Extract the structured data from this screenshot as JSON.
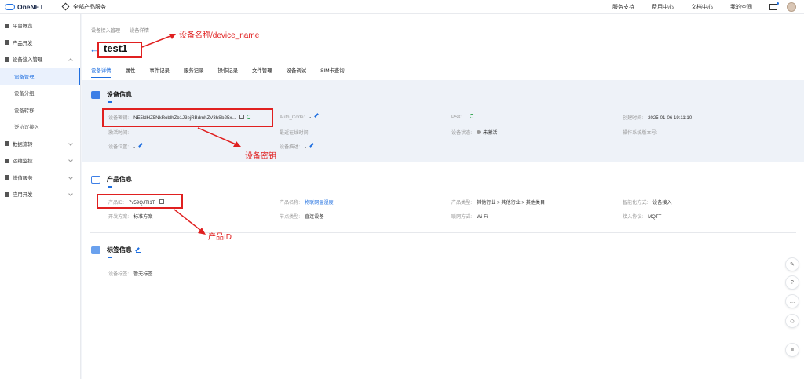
{
  "topbar": {
    "logo": "OneNET",
    "all_products": "全部产品服务",
    "links": [
      "服务支持",
      "费用中心",
      "文档中心",
      "我的空间"
    ]
  },
  "sidebar": {
    "items": [
      {
        "label": "平台概览"
      },
      {
        "label": "产品开发"
      },
      {
        "label": "设备接入管理"
      },
      {
        "label": "设备管理"
      },
      {
        "label": "设备分组"
      },
      {
        "label": "设备转移"
      },
      {
        "label": "泛协议接入"
      },
      {
        "label": "数据流转"
      },
      {
        "label": "运维监控"
      },
      {
        "label": "增值服务"
      },
      {
        "label": "应用开发"
      }
    ]
  },
  "breadcrumb": {
    "parent": "设备接入管理",
    "sep": "-",
    "current": "设备详情"
  },
  "device": {
    "name": "test1"
  },
  "tabs": [
    "设备详情",
    "属性",
    "事件记录",
    "服务记录",
    "操作记录",
    "文件管理",
    "设备调试",
    "SIM卡查询"
  ],
  "device_info": {
    "title": "设备信息",
    "key_label": "设备密钥:",
    "key_value": "NE5ldHZ5NkRoblhZb1J3ejRBdmhZV3hSb25x...",
    "auth_label": "Auth_Code:",
    "auth_value": "-",
    "psk_label": "PSK:",
    "created_label": "创建时间:",
    "created_value": "2025-01-06 19:11:10",
    "activated_label": "激活时间:",
    "activated_value": "-",
    "last_online_label": "最近在线时间:",
    "last_online_value": "-",
    "status_label": "设备状态:",
    "status_value": "未激活",
    "os_label": "操作系统版本号:",
    "os_value": "-",
    "location_label": "设备位置:",
    "location_value": "-",
    "desc_label": "设备描述:",
    "desc_value": "-"
  },
  "product_info": {
    "title": "产品信息",
    "id_label": "产品ID:",
    "id_value": "7v59QJTI1T",
    "name_label": "产品名称:",
    "name_value": "物联网温湿度",
    "type_label": "产品类型:",
    "type_value": "其他行业 > 其他行业 > 其他类目",
    "smart_label": "智能化方式:",
    "smart_value": "设备接入",
    "plan_label": "开发方案:",
    "plan_value": "标准方案",
    "node_label": "节点类型:",
    "node_value": "直连设备",
    "net_label": "联网方式:",
    "net_value": "Wi-Fi",
    "proto_label": "接入协议:",
    "proto_value": "MQTT"
  },
  "tag_info": {
    "title": "标签信息",
    "label": "设备标签:",
    "value": "暂无标签"
  },
  "annotations": {
    "device_name": "设备名称/device_name",
    "device_key": "设备密钥",
    "product_id": "产品ID",
    "color": "#e02020"
  },
  "colors": {
    "accent": "#1f6fe0",
    "band": "#eef2f8"
  }
}
